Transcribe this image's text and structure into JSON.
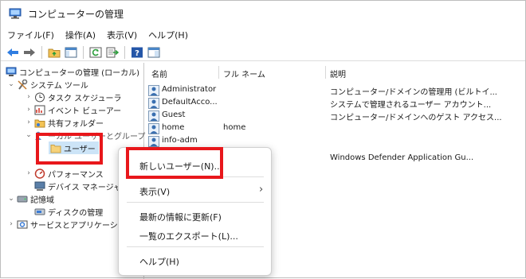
{
  "window": {
    "title": "コンピューターの管理"
  },
  "menu": [
    "ファイル(F)",
    "操作(A)",
    "表示(V)",
    "ヘルプ(H)"
  ],
  "tree": {
    "root": "コンピューターの管理 (ローカル)",
    "system_tools": "システム ツール",
    "task_scheduler": "タスク スケジューラ",
    "event_viewer": "イベント ビューアー",
    "shared_folders": "共有フォルダー",
    "local_users_groups_fragment": "ーカル ユーザーとグループ",
    "users": "ユーザー",
    "performance": "パフォーマンス",
    "device_manager": "デバイス マネージャー",
    "storage": "記憶域",
    "disk_management": "ディスクの管理",
    "services_apps": "サービスとアプリケーション"
  },
  "columns": {
    "name": "名前",
    "fullname": "フル ネーム",
    "description": "説明"
  },
  "users": [
    {
      "name": "Administrator",
      "fullname": "",
      "description": "コンピューター/ドメインの管理用 (ビルトイ..."
    },
    {
      "name": "DefaultAcco...",
      "fullname": "",
      "description": "システムで管理されるユーザー アカウント..."
    },
    {
      "name": "Guest",
      "fullname": "",
      "description": "コンピューター/ドメインへのゲスト アクセス..."
    },
    {
      "name": "home",
      "fullname": "home",
      "description": ""
    },
    {
      "name": "info-adm",
      "fullname": "",
      "description": ""
    },
    {
      "name": "",
      "fullname": "",
      "description": "Windows Defender Application Gu..."
    }
  ],
  "context_menu": {
    "new_user": "新しいユーザー(N)...",
    "view": "表示(V)",
    "view_arrow": "›",
    "refresh": "最新の情報に更新(F)",
    "export": "一覧のエクスポート(L)...",
    "help": "ヘルプ(H)"
  },
  "colors": {
    "highlight": "#e8171b",
    "selection": "#cce4f7"
  }
}
